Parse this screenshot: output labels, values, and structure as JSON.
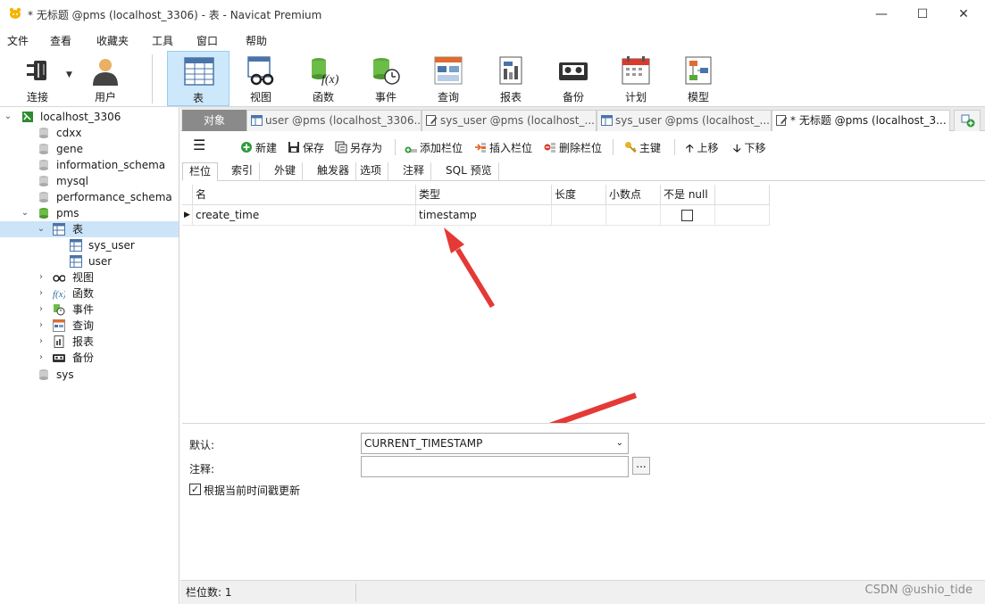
{
  "window": {
    "title": "* 无标题 @pms (localhost_3306) - 表 - Navicat Premium",
    "minimize": "—",
    "maximize": "☐",
    "close": "✕"
  },
  "menu": [
    "文件",
    "查看",
    "收藏夹",
    "工具",
    "窗口",
    "帮助"
  ],
  "toolbar": [
    {
      "label": "连接",
      "icon": "plug-icon"
    },
    {
      "label": "用户",
      "icon": "user-icon"
    },
    {
      "label": "表",
      "icon": "table-icon",
      "active": true
    },
    {
      "label": "视图",
      "icon": "view-icon"
    },
    {
      "label": "函数",
      "icon": "function-icon"
    },
    {
      "label": "事件",
      "icon": "event-icon"
    },
    {
      "label": "查询",
      "icon": "query-icon"
    },
    {
      "label": "报表",
      "icon": "report-icon"
    },
    {
      "label": "备份",
      "icon": "backup-icon"
    },
    {
      "label": "计划",
      "icon": "schedule-icon"
    },
    {
      "label": "模型",
      "icon": "model-icon"
    }
  ],
  "tree": {
    "connection": "localhost_3306",
    "databases": [
      "cdxx",
      "gene",
      "information_schema",
      "mysql",
      "performance_schema",
      "pms",
      "sys"
    ],
    "pms_children": {
      "tables_label": "表",
      "tables": [
        "sys_user",
        "user"
      ],
      "others": [
        "视图",
        "函数",
        "事件",
        "查询",
        "报表",
        "备份"
      ]
    }
  },
  "tabs": [
    {
      "label": "对象"
    },
    {
      "label": "user @pms (localhost_3306..."
    },
    {
      "label": "sys_user @pms (localhost_..."
    },
    {
      "label": "sys_user @pms (localhost_..."
    },
    {
      "label": "* 无标题 @pms (localhost_3..."
    }
  ],
  "design_toolbar": {
    "new": "新建",
    "save": "保存",
    "save_as": "另存为",
    "add_field": "添加栏位",
    "insert_field": "插入栏位",
    "delete_field": "删除栏位",
    "primary_key": "主键",
    "move_up": "上移",
    "move_down": "下移"
  },
  "sub_tabs": [
    "栏位",
    "索引",
    "外键",
    "触发器",
    "选项",
    "注释",
    "SQL 预览"
  ],
  "grid": {
    "headers": [
      "名",
      "类型",
      "长度",
      "小数点",
      "不是 null"
    ],
    "rows": [
      {
        "name": "create_time",
        "type": "timestamp",
        "length": "",
        "decimals": "",
        "not_null": false
      }
    ]
  },
  "props": {
    "default_label": "默认:",
    "default_value": "CURRENT_TIMESTAMP",
    "comment_label": "注释:",
    "comment_value": "",
    "comment_btn": "...",
    "update_label": "根据当前时间戳更新",
    "update_checked": true
  },
  "status": {
    "field_count": "栏位数: 1"
  },
  "watermark": "CSDN @ushio_tide",
  "colors": {
    "accent": "#cde8fb",
    "arrow": "#e53935",
    "tab_obj": "#8a8a8a"
  }
}
